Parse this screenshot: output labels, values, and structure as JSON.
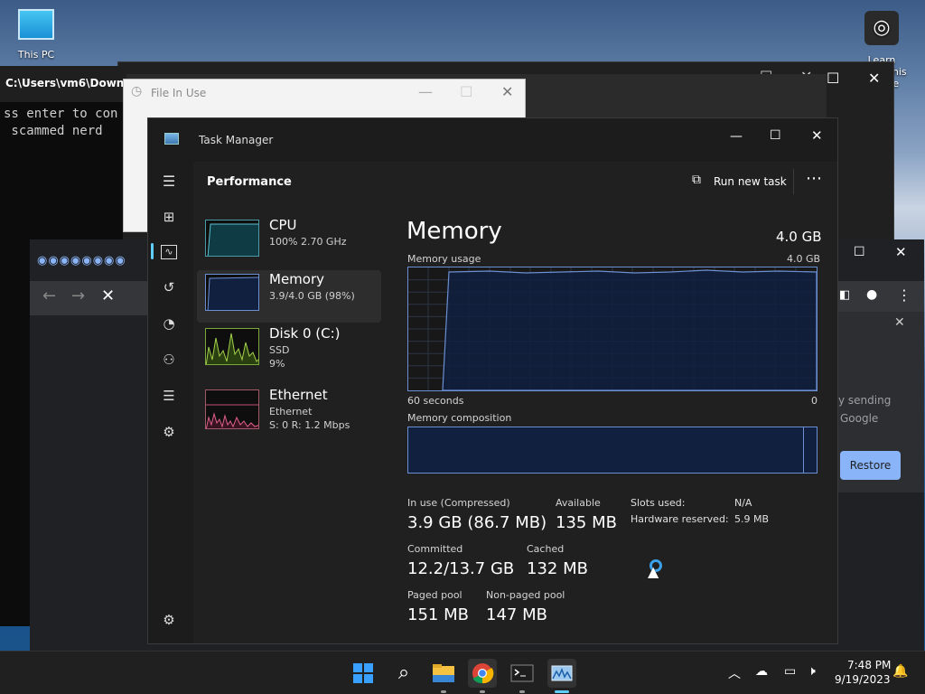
{
  "desktop": {
    "icon1_label": "This PC",
    "icon2_label": "Learn about this picture"
  },
  "console": {
    "title": "C:\\Users\\vm6\\Downlo",
    "lines": [
      "ss enter to con",
      " scammed nerd"
    ]
  },
  "file_in_use": {
    "title": "File In Use"
  },
  "chrome": {
    "dialog_text1": "y sending",
    "dialog_text2": "Google",
    "restore_label": "Restore"
  },
  "taskmgr": {
    "title": "Task Manager",
    "section": "Performance",
    "run_new_task": "Run new task",
    "processes": [
      {
        "name": "CPU",
        "line1": "100% 2.70 GHz",
        "line2": ""
      },
      {
        "name": "Memory",
        "line1": "3.9/4.0 GB (98%)",
        "line2": ""
      },
      {
        "name": "Disk 0 (C:)",
        "line1": "SSD",
        "line2": "9%"
      },
      {
        "name": "Ethernet",
        "line1": "Ethernet",
        "line2": "S: 0 R: 1.2 Mbps"
      }
    ],
    "heading": "Memory",
    "total": "4.0 GB",
    "usage_label": "Memory usage",
    "usage_max": "4.0 GB",
    "time_left": "60 seconds",
    "time_right": "0",
    "composition_label": "Memory composition",
    "stats": {
      "in_use_label": "In use (Compressed)",
      "in_use_value": "3.9 GB (86.7 MB)",
      "available_label": "Available",
      "available_value": "135 MB",
      "committed_label": "Committed",
      "committed_value": "12.2/13.7 GB",
      "cached_label": "Cached",
      "cached_value": "132 MB",
      "paged_label": "Paged pool",
      "paged_value": "151 MB",
      "nonpaged_label": "Non-paged pool",
      "nonpaged_value": "147 MB",
      "slots_label": "Slots used:",
      "slots_value": "N/A",
      "hw_label": "Hardware reserved:",
      "hw_value": "5.9 MB"
    }
  },
  "taskbar": {
    "time": "7:48 PM",
    "date": "9/19/2023"
  },
  "colors": {
    "accent": "#60cdff",
    "memory_fill": "#11203f",
    "memory_line": "#6c8fd1"
  }
}
